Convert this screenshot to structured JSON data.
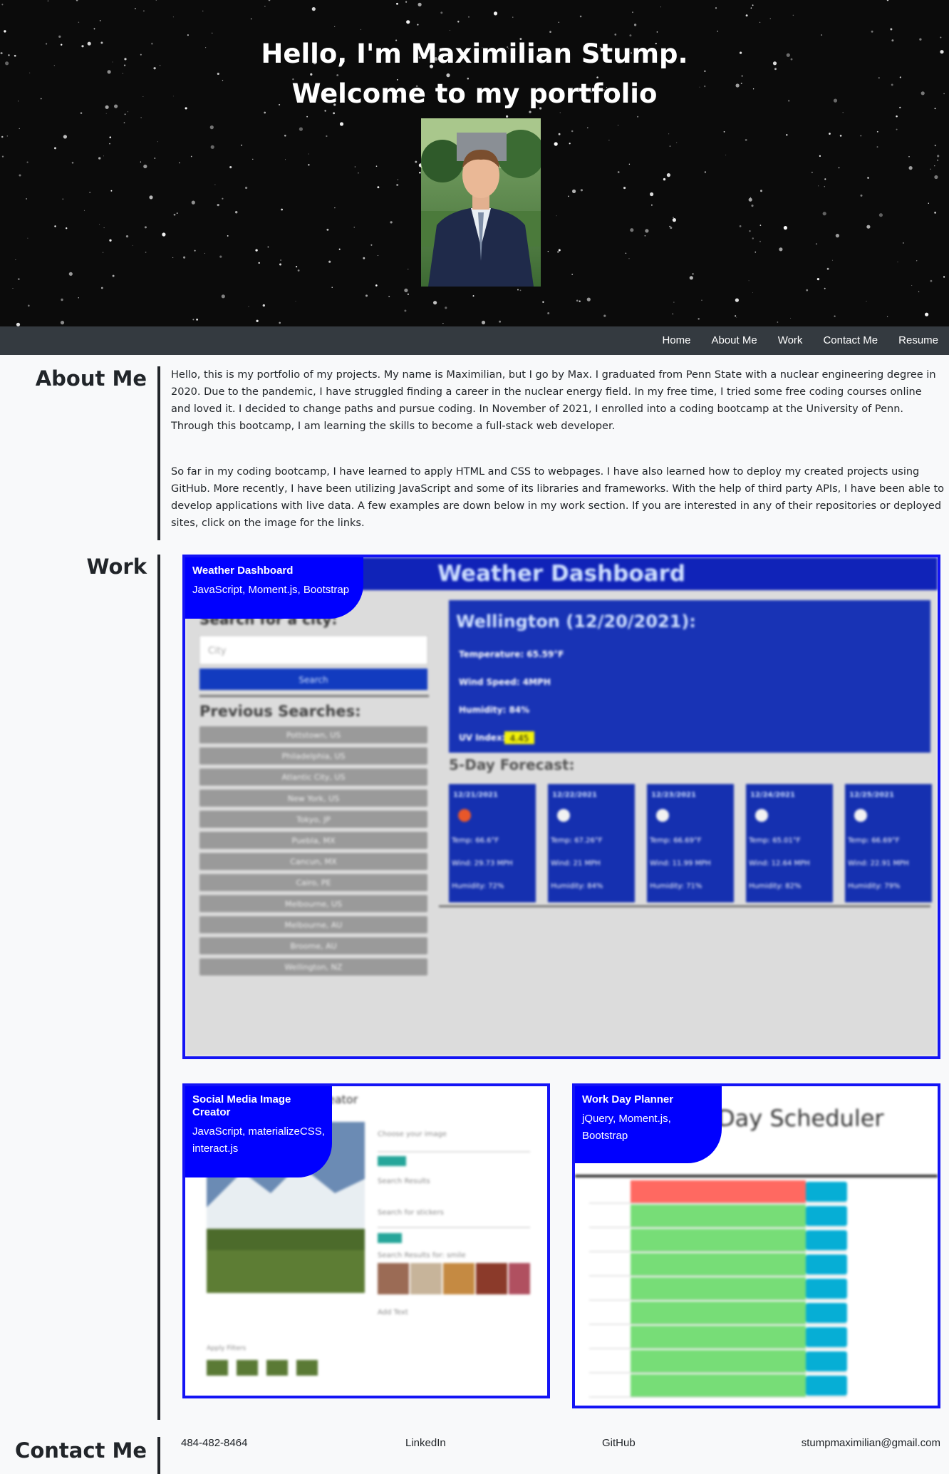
{
  "hero": {
    "title_line1": "Hello, I'm Maximilian Stump.",
    "title_line2": "Welcome to my portfolio"
  },
  "nav": {
    "items": [
      "Home",
      "About Me",
      "Work",
      "Contact Me",
      "Resume"
    ]
  },
  "about": {
    "heading": "About Me",
    "paragraph1": "Hello, this is my portfolio of my projects. My name is Maximilian, but I go by Max. I graduated from Penn State with a nuclear engineering degree in 2020. Due to the pandemic, I have struggled finding a career in the nuclear energy field. In my free time, I tried some free coding courses online and loved it. I decided to change paths and pursue coding. In November of 2021, I enrolled into a coding bootcamp at the University of Penn. Through this bootcamp, I am learning the skills to become a full-stack web developer.",
    "paragraph2": "So far in my coding bootcamp, I have learned to apply HTML and CSS to webpages. I have also learned how to deploy my created projects using GitHub. More recently, I have been utilizing JavaScript and some of its libraries and frameworks. With the help of third party APIs, I have been able to develop applications with live data. A few examples are down below in my work section. If you are interested in any of their repositories or deployed sites, click on the image for the links."
  },
  "work": {
    "heading": "Work",
    "projects": [
      {
        "title": "Weather Dashboard",
        "tech": "JavaScript, Moment.js, Bootstrap"
      },
      {
        "title": "Social Media Image Creator",
        "tech": "JavaScript, materializeCSS, interact.js"
      },
      {
        "title": "Work Day Planner",
        "tech": "jQuery, Moment.js, Bootstrap"
      }
    ],
    "weather_preview": {
      "app_title": "Weather Dashboard",
      "search_heading": "Search for a city:",
      "city_placeholder": "City",
      "search_button": "Search",
      "previous_heading": "Previous Searches:",
      "previous": [
        "Pottstown, US",
        "Philadelphia, US",
        "Atlantic City, US",
        "New York, US",
        "Tokyo, JP",
        "Puebla, MX",
        "Cancun, MX",
        "Cairo, PE",
        "Melbourne, US",
        "Melbourne, AU",
        "Broome, AU",
        "Wellington, NZ"
      ],
      "current_city": "Wellington (12/20/2021):",
      "temperature": "Temperature: 65.59°F",
      "wind": "Wind Speed: 4MPH",
      "humidity": "Humidity: 84%",
      "uv_label": "UV Index:",
      "uv_value": "4.45",
      "forecast_heading": "5-Day Forecast:",
      "forecast": [
        {
          "date": "12/21/2021",
          "temp": "Temp: 66.6°F",
          "wind": "Wind: 29.73 MPH",
          "hum": "Humidity: 72%"
        },
        {
          "date": "12/22/2021",
          "temp": "Temp: 67.26°F",
          "wind": "Wind: 21 MPH",
          "hum": "Humidity: 84%"
        },
        {
          "date": "12/23/2021",
          "temp": "Temp: 66.69°F",
          "wind": "Wind: 11.99 MPH",
          "hum": "Humidity: 71%"
        },
        {
          "date": "12/24/2021",
          "temp": "Temp: 65.01°F",
          "wind": "Wind: 12.64 MPH",
          "hum": "Humidity: 82%"
        },
        {
          "date": "12/25/2021",
          "temp": "Temp: 66.69°F",
          "wind": "Wind: 22.91 MPH",
          "hum": "Humidity: 79%"
        }
      ]
    },
    "social_preview": {
      "app_title_fragment": "eator",
      "choose_image": "Choose your image",
      "search_results": "Search Results",
      "search_stickers": "Search for stickers",
      "search_results_smile": "Search Results for: smile",
      "add_text": "Add Text",
      "apply_filters": "Apply Filters"
    },
    "planner_preview": {
      "app_title_fragment": "Day Scheduler"
    }
  },
  "contact": {
    "heading": "Contact Me",
    "phone": "484-482-8464",
    "linkedin": "LinkedIn",
    "github": "GitHub",
    "email": "stumpmaximilian@gmail.com"
  },
  "colors": {
    "navbar": "#343a40",
    "card_border": "#1414f5",
    "card_label": "#0000ff",
    "planner_past": "#ff6961",
    "planner_future": "#77dd77",
    "planner_save": "#06aed5"
  }
}
